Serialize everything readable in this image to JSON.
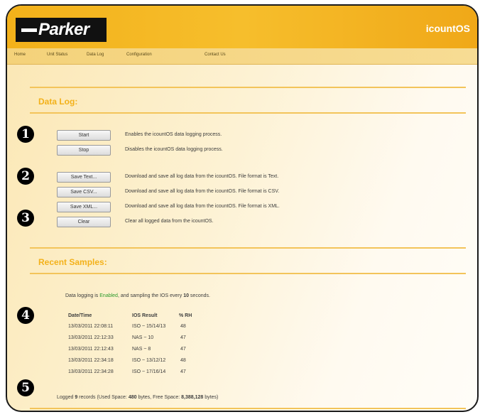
{
  "header": {
    "logo_text": "Parker",
    "app_title": "icountOS"
  },
  "nav": {
    "items": [
      "Home",
      "Unit Status",
      "Data Log",
      "Configuration",
      "Contact Us"
    ]
  },
  "data_log": {
    "title": "Data Log:",
    "actions": [
      {
        "label": "Start",
        "description": "Enables the icountOS data logging process."
      },
      {
        "label": "Stop",
        "description": "Disables the icountOS data logging process."
      },
      {
        "label": "Save Text...",
        "description": "Download and save all log data from the icountOS. File format is Text."
      },
      {
        "label": "Save CSV...",
        "description": "Download and save all log data from the icountOS. File format is CSV."
      },
      {
        "label": "Save XML...",
        "description": "Download and save all log data from the icountOS. File format is XML."
      },
      {
        "label": "Clear",
        "description": "Clear all logged data from the icountOS."
      }
    ]
  },
  "recent_samples": {
    "title": "Recent Samples:",
    "status": {
      "prefix": "Data logging is ",
      "state": "Enabled",
      "middle": ", and sampling the IOS every ",
      "interval": "10",
      "suffix": " seconds.",
      "state_color": "#2a9a2a"
    },
    "columns": [
      "Date/Time",
      "IOS Result",
      "% RH"
    ],
    "rows": [
      [
        "13/03/2011 22:08:11",
        "ISO ~ 15/14/13",
        "48"
      ],
      [
        "13/03/2011 22:12:33",
        "NAS ~ 10",
        "47"
      ],
      [
        "13/03/2011 22:12:43",
        "NAS ~ 8",
        "47"
      ],
      [
        "13/03/2011 22:34:18",
        "ISO ~ 13/12/12",
        "48"
      ],
      [
        "13/03/2011 22:34:28",
        "ISO ~ 17/16/14",
        "47"
      ]
    ],
    "summary": {
      "prefix": "Logged ",
      "records": "9",
      "middle1": " records (Used Space: ",
      "used": "480",
      "middle2": " bytes, Free Space: ",
      "free": "8,388,128",
      "suffix": " bytes)"
    }
  },
  "callouts": [
    "1",
    "2",
    "3",
    "4",
    "5"
  ],
  "colors": {
    "brand_yellow": "#f3b11a",
    "accent_title": "#f3b11a",
    "enabled_green": "#2a9a2a"
  }
}
